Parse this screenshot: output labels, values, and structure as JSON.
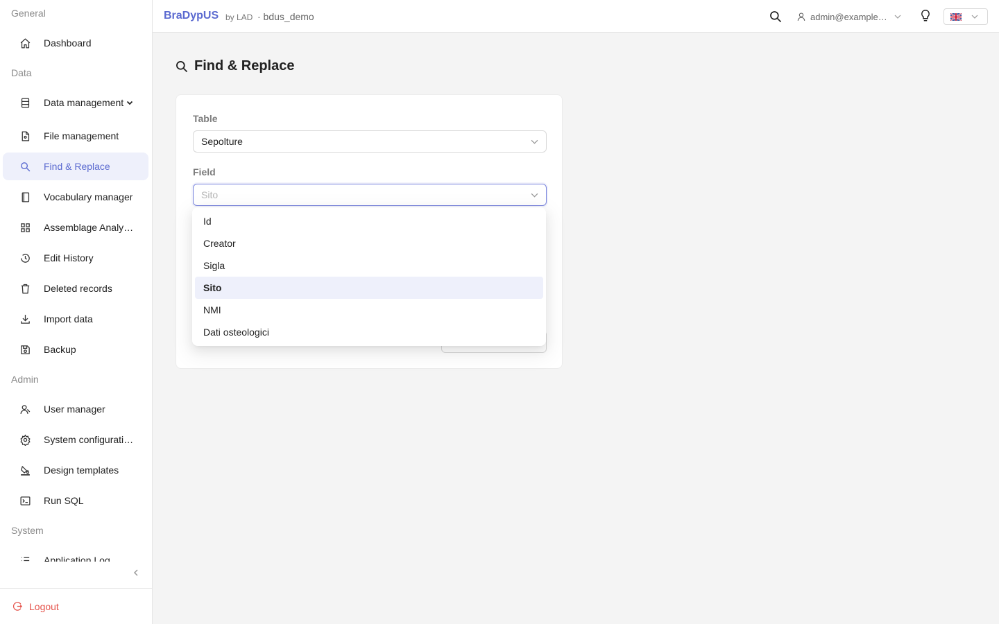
{
  "sidebar": {
    "sections": {
      "general": "General",
      "data": "Data",
      "admin": "Admin",
      "system": "System"
    },
    "items": {
      "dashboard": "Dashboard",
      "data_management": "Data management",
      "file_management": "File management",
      "find_replace": "Find & Replace",
      "vocabulary_manager": "Vocabulary manager",
      "assemblage_analysis": "Assemblage Analy…",
      "edit_history": "Edit History",
      "deleted_records": "Deleted records",
      "import_data": "Import data",
      "backup": "Backup",
      "user_manager": "User manager",
      "system_configuration": "System configurati…",
      "design_templates": "Design templates",
      "run_sql": "Run SQL",
      "application_log": "Application Log"
    },
    "active_item": "find_replace",
    "logout_label": "Logout"
  },
  "header": {
    "brand": "BraDypUS",
    "brand_by": "by LAD",
    "database": "· bdus_demo",
    "user": "admin@example…",
    "language_flag": "uk-flag-icon"
  },
  "page": {
    "title": "Find & Replace"
  },
  "form": {
    "table_label": "Table",
    "table_value": "Sepolture",
    "field_label": "Field",
    "field_placeholder": "Sito"
  },
  "dropdown": {
    "options": [
      "Id",
      "Creator",
      "Sigla",
      "Sito",
      "NMI",
      "Dati osteologici"
    ],
    "selected": "Sito"
  },
  "colors": {
    "accent": "#5b6ad0",
    "active_bg": "#eef0fb",
    "logout": "#e5534b",
    "background": "#f4f4f4"
  }
}
